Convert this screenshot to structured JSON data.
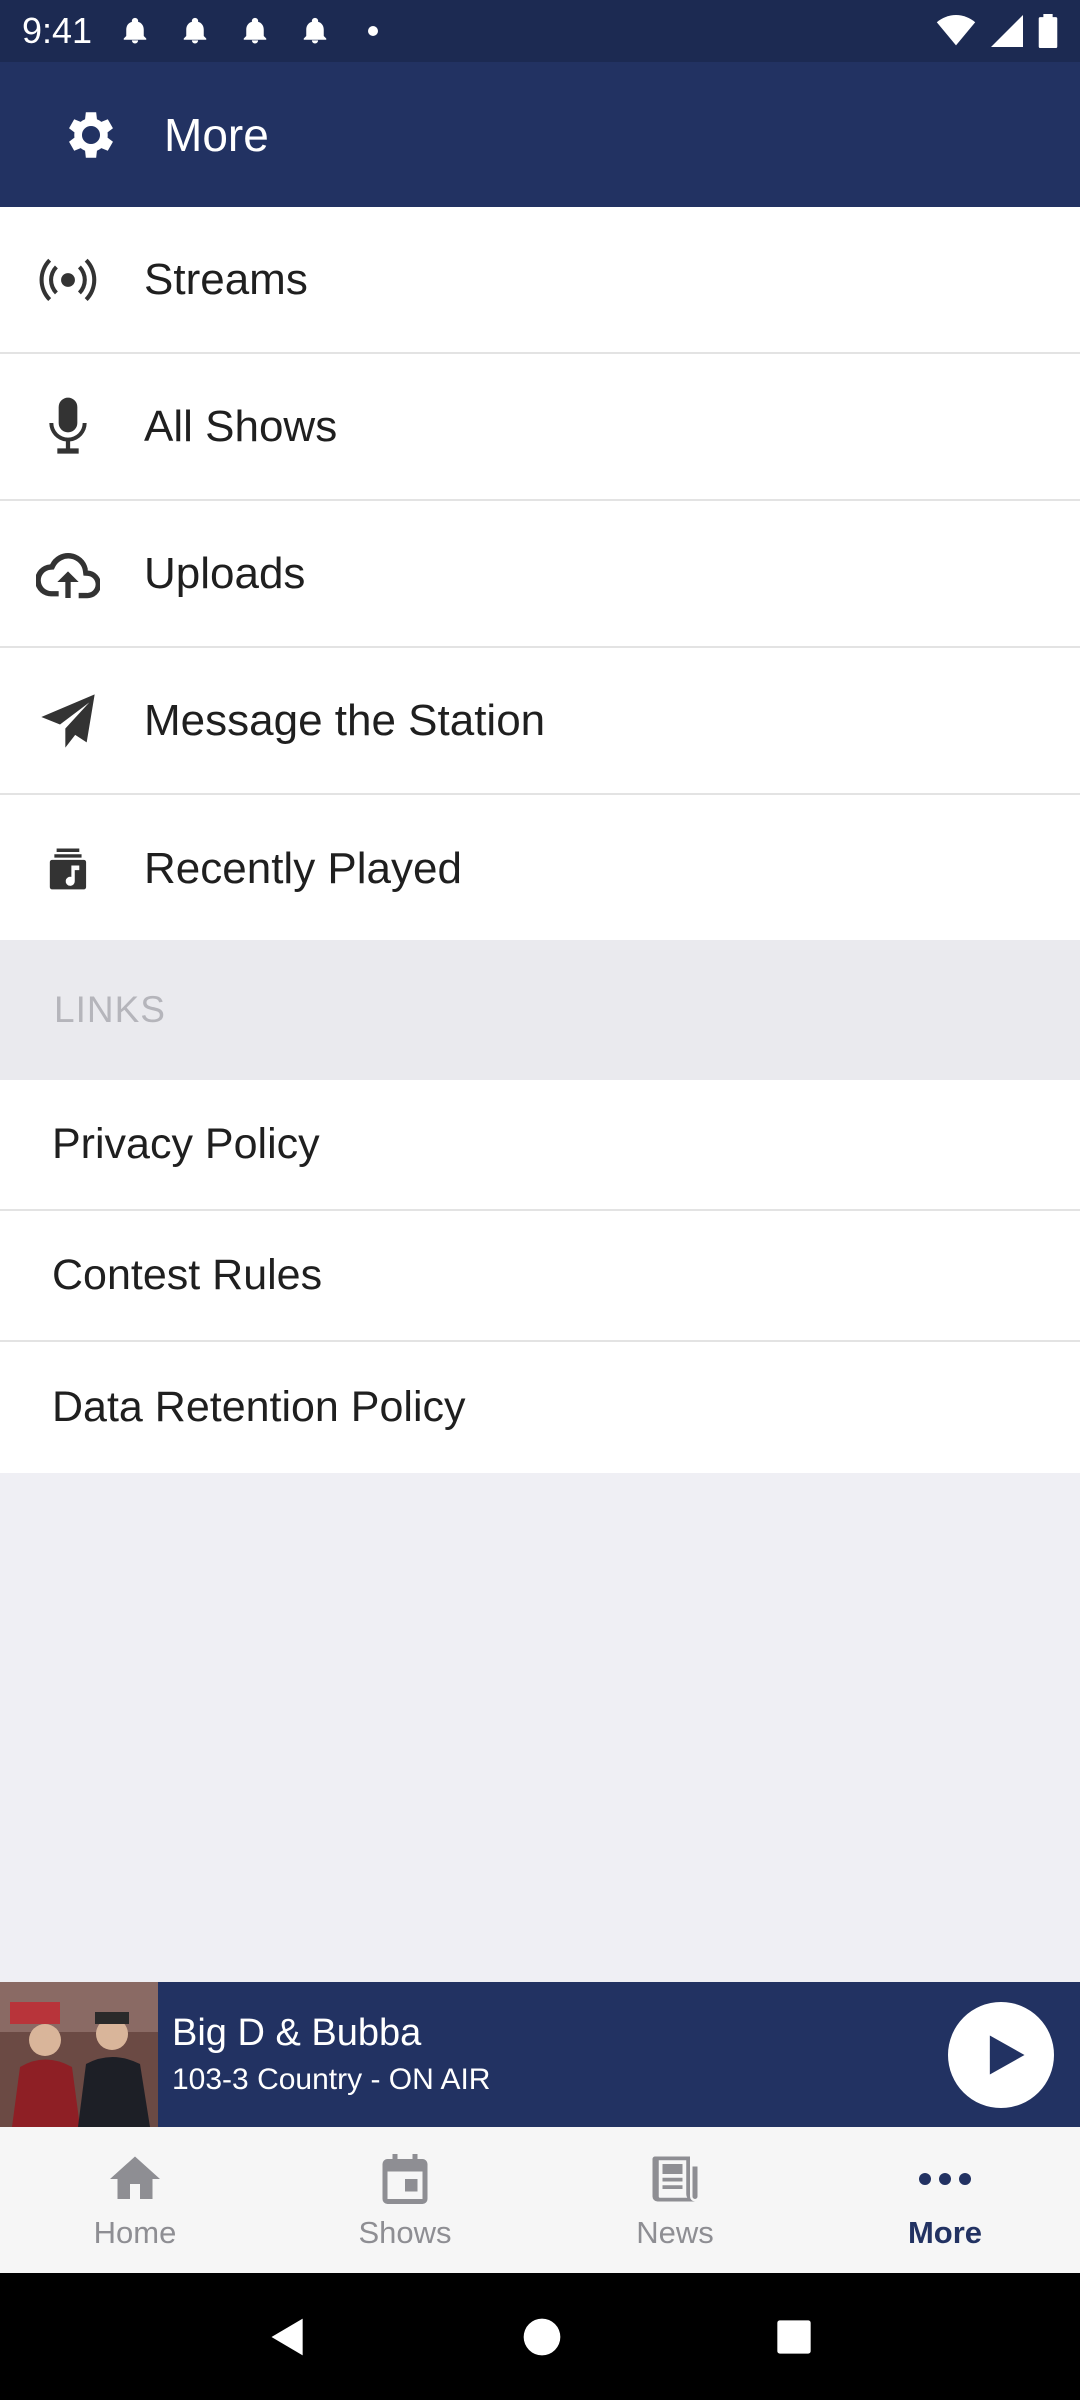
{
  "status_bar": {
    "time": "9:41",
    "notification_icons": [
      "bell-icon",
      "bell-icon",
      "bell-icon",
      "bell-icon"
    ],
    "wifi_icon": "wifi-icon",
    "signal_icon": "signal-icon",
    "battery_icon": "battery-icon"
  },
  "app_bar": {
    "title": "More",
    "icon": "gear-icon"
  },
  "menu": {
    "items": [
      {
        "label": "Streams",
        "icon": "broadcast-icon"
      },
      {
        "label": "All Shows",
        "icon": "microphone-icon"
      },
      {
        "label": "Uploads",
        "icon": "cloud-upload-icon"
      },
      {
        "label": "Message the Station",
        "icon": "paper-plane-icon"
      },
      {
        "label": "Recently Played",
        "icon": "music-queue-icon"
      }
    ]
  },
  "links": {
    "header": "LINKS",
    "items": [
      {
        "label": "Privacy Policy"
      },
      {
        "label": "Contest Rules"
      },
      {
        "label": "Data Retention Policy"
      }
    ]
  },
  "now_playing": {
    "title": "Big D & Bubba",
    "subtitle": "103-3 Country - ON AIR",
    "play_icon": "play-icon"
  },
  "bottom_nav": {
    "items": [
      {
        "label": "Home",
        "icon": "home-icon",
        "active": false
      },
      {
        "label": "Shows",
        "icon": "calendar-icon",
        "active": false
      },
      {
        "label": "News",
        "icon": "newspaper-icon",
        "active": false
      },
      {
        "label": "More",
        "icon": "more-dots-icon",
        "active": true
      }
    ]
  },
  "colors": {
    "primary": "#223262",
    "status_bar": "#1c2a52",
    "background": "#efeff4",
    "inactive": "#8e8e93"
  }
}
